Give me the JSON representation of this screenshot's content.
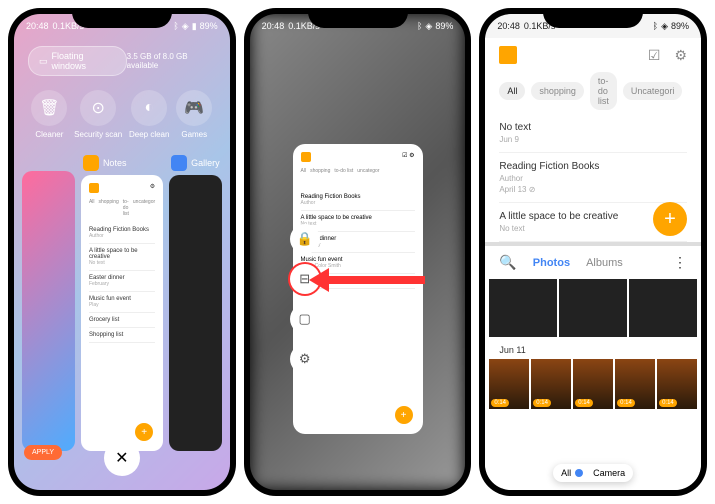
{
  "status": {
    "time": "20:48",
    "speed": "0.1KB/s",
    "battery": "89%"
  },
  "p1": {
    "floating": "Floating windows",
    "storage": "3.5 GB of 8.0 GB available",
    "tools": [
      {
        "l": "Cleaner"
      },
      {
        "l": "Security scan"
      },
      {
        "l": "Deep clean"
      },
      {
        "l": "Games"
      }
    ],
    "apps": {
      "notes": "Notes",
      "gallery": "Gallery"
    },
    "apply": "APPLY",
    "mini": {
      "tabs": [
        "All",
        "shopping",
        "to-do list",
        "uncategor"
      ],
      "notes": [
        {
          "t": "Reading Fiction Books",
          "s": "Author"
        },
        {
          "t": "A little space to be creative",
          "s": "No text"
        },
        {
          "t": "Easter dinner",
          "s": "February"
        },
        {
          "t": "Music fun event",
          "s": "Play"
        },
        {
          "t": "Grocery list",
          "s": ""
        },
        {
          "t": "Shopping list",
          "s": ""
        }
      ]
    }
  },
  "p2": {
    "notes": [
      {
        "t": "Reading Fiction Books",
        "s": "Author"
      },
      {
        "t": "A little space to be creative",
        "s": "No text"
      },
      {
        "t": "Easter dinner",
        "s": "February"
      },
      {
        "t": "Music fun event",
        "s": "Play · Color Smith"
      },
      {
        "t": "Grocery list",
        "s": ""
      }
    ]
  },
  "p3": {
    "tabs": [
      "All",
      "shopping",
      "to-do list",
      "Uncategori"
    ],
    "notes": [
      {
        "t": "No text",
        "d": "Jun 9"
      },
      {
        "t": "Reading Fiction Books",
        "s": "Author",
        "d": "April 13 ⊘"
      },
      {
        "t": "A little space to be creative",
        "s": "No text"
      }
    ],
    "gallery": {
      "photos": "Photos",
      "albums": "Albums",
      "date": "Jun 11",
      "all": "All",
      "camera": "Camera",
      "durations": [
        "0:14",
        "0:14",
        "0:14",
        "0:14",
        "0:14"
      ]
    }
  }
}
